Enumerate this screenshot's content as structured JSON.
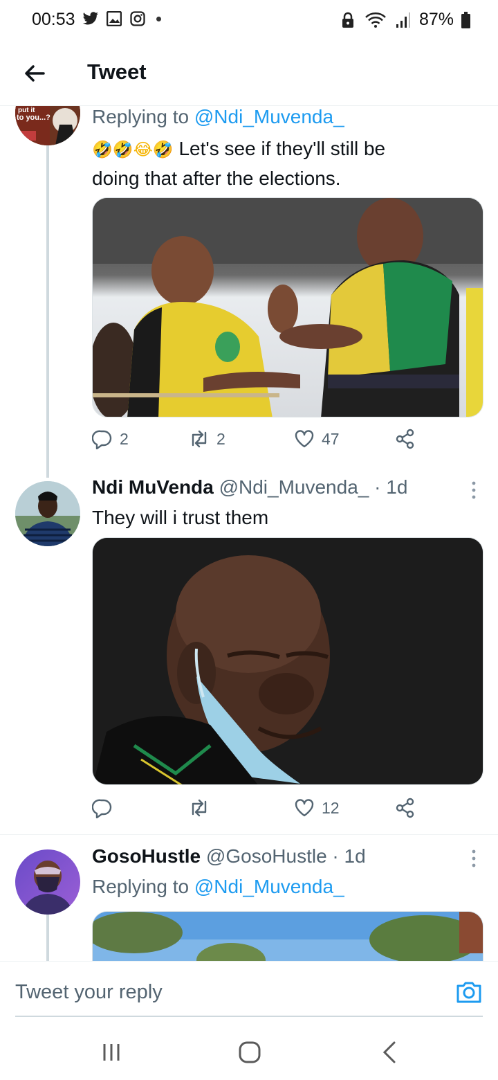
{
  "status_bar": {
    "time": "00:53",
    "left_icons": [
      "twitter-icon",
      "gallery-icon",
      "instagram-icon",
      "dot-icon"
    ],
    "right_icons": [
      "lock-icon",
      "wifi-icon",
      "signal-icon",
      "battery-icon"
    ],
    "battery": "87%"
  },
  "header": {
    "title": "Tweet",
    "back_icon": "back-arrow-icon"
  },
  "tweets": [
    {
      "replying_label": "Replying to",
      "replying_handle": "@Ndi_Muvenda_",
      "emojis": "🤣🤣😂🤣",
      "text_line1": "Let's see if they'll still be",
      "text_line2": "doing that after the elections.",
      "reply_count": "2",
      "retweet_count": "2",
      "like_count": "47",
      "avatar_text_1": "put it",
      "avatar_text_2": "to you...?"
    },
    {
      "name": "Ndi MuVenda",
      "handle": "@Ndi_Muvenda_",
      "sep": "·",
      "time": "1d",
      "text": "They will i trust them",
      "reply_count": "",
      "retweet_count": "",
      "like_count": "12"
    },
    {
      "name": "GosoHustle",
      "handle": "@GosoHustle",
      "sep": "·",
      "time": "1d",
      "replying_label": "Replying to",
      "replying_handle": "@Ndi_Muvenda_"
    }
  ],
  "reply_bar": {
    "placeholder": "Tweet your reply",
    "camera_icon": "camera-icon"
  },
  "nav_bar": {
    "icons": [
      "recents-icon",
      "home-icon",
      "back-icon"
    ]
  },
  "colors": {
    "accent": "#1d9bf0",
    "text_primary": "#0f1419",
    "text_secondary": "#536471",
    "divider": "#eff3f4"
  }
}
